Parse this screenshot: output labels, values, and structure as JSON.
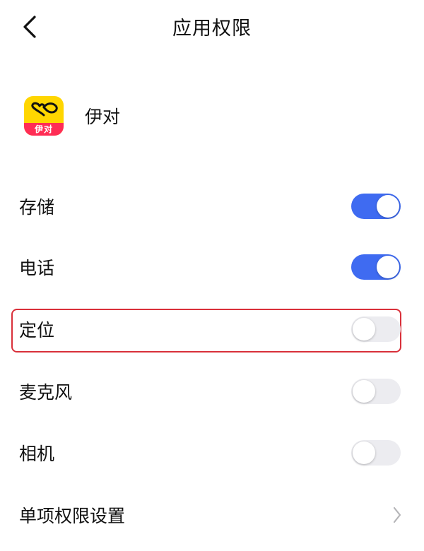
{
  "header": {
    "title": "应用权限",
    "back_icon": "chevron-left-icon"
  },
  "app": {
    "name": "伊对",
    "icon_text": "伊对",
    "icon_colors": {
      "background": "#FFD600",
      "ribbon": "#FF2D55"
    }
  },
  "permissions": [
    {
      "label": "存储",
      "enabled": true
    },
    {
      "label": "电话",
      "enabled": true
    },
    {
      "label": "定位",
      "enabled": false,
      "highlighted": true
    },
    {
      "label": "麦克风",
      "enabled": false
    },
    {
      "label": "相机",
      "enabled": false
    }
  ],
  "individual_settings": {
    "label": "单项权限设置",
    "icon": "chevron-right-icon"
  },
  "colors": {
    "toggle_on": "#3F6BF1",
    "toggle_off": "#ECECF0",
    "highlight_border": "#D9303A"
  }
}
